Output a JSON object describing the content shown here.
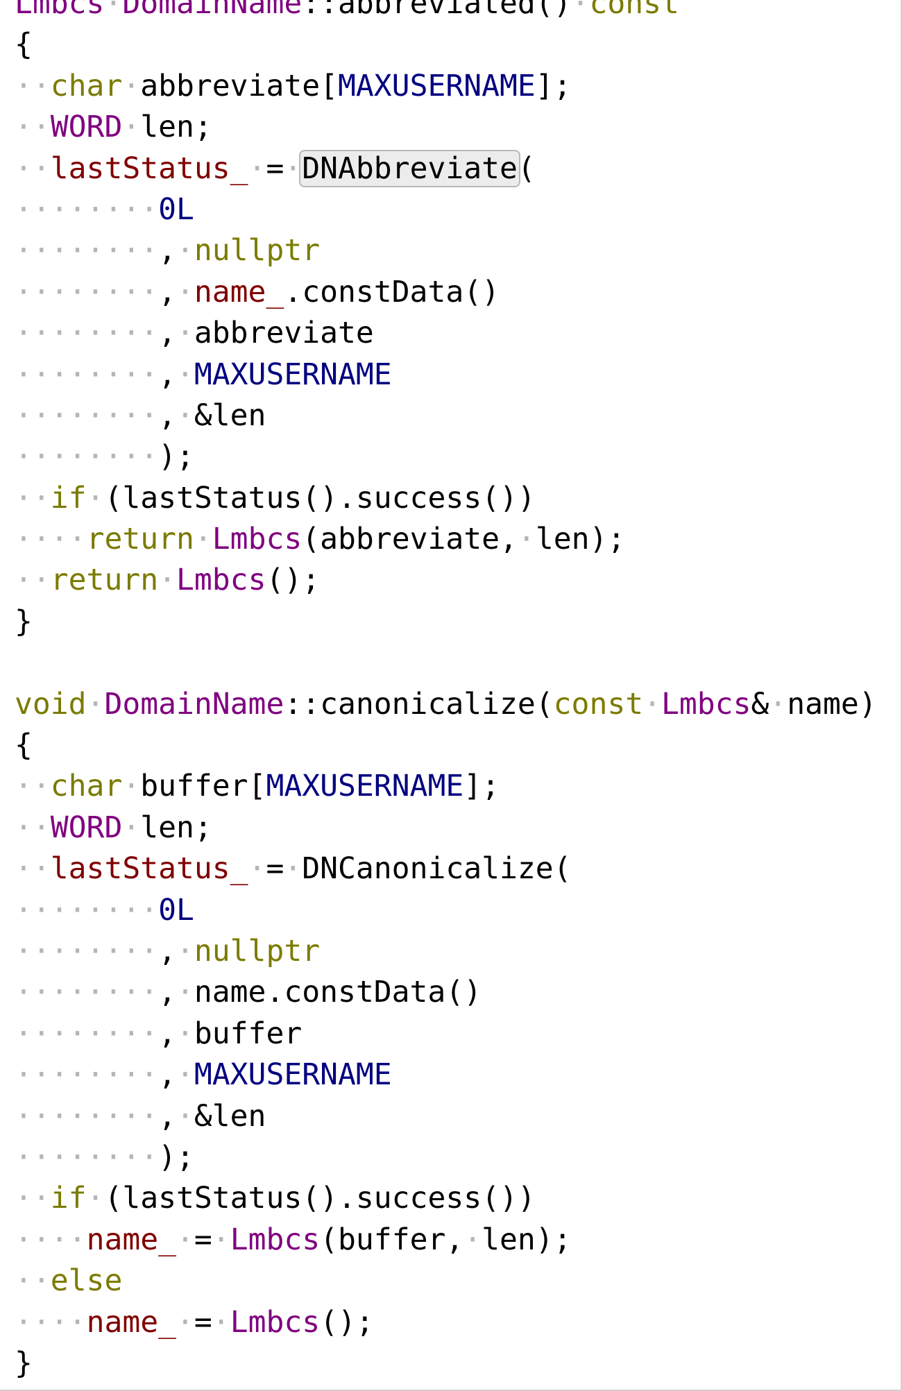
{
  "colors": {
    "plain": "#000000",
    "keyword": "#7b7b00",
    "type": "#800080",
    "constant": "#000080",
    "member": "#800000",
    "whitespace_marker": "#b5b5b5"
  },
  "code": {
    "lines": [
      [
        [
          "type",
          "Lmbcs"
        ],
        [
          "ws",
          "·"
        ],
        [
          "type",
          "DomainName"
        ],
        [
          "plain",
          "::abbreviated()"
        ],
        [
          "ws",
          "·"
        ],
        [
          "keyword",
          "const"
        ]
      ],
      [
        [
          "plain",
          "{"
        ]
      ],
      [
        [
          "ws",
          "··"
        ],
        [
          "keyword",
          "char"
        ],
        [
          "ws",
          "·"
        ],
        [
          "plain",
          "abbreviate["
        ],
        [
          "constant",
          "MAXUSERNAME"
        ],
        [
          "plain",
          "];"
        ]
      ],
      [
        [
          "ws",
          "··"
        ],
        [
          "type",
          "WORD"
        ],
        [
          "ws",
          "·"
        ],
        [
          "plain",
          "len;"
        ]
      ],
      [
        [
          "ws",
          "··"
        ],
        [
          "member",
          "lastStatus_"
        ],
        [
          "ws",
          "·"
        ],
        [
          "plain",
          "="
        ],
        [
          "ws",
          "·"
        ],
        [
          "highlight",
          "DNAbbreviate"
        ],
        [
          "plain",
          "("
        ]
      ],
      [
        [
          "ws",
          "········"
        ],
        [
          "constant",
          "0L"
        ]
      ],
      [
        [
          "ws",
          "········"
        ],
        [
          "plain",
          ","
        ],
        [
          "ws",
          "·"
        ],
        [
          "keyword",
          "nullptr"
        ]
      ],
      [
        [
          "ws",
          "········"
        ],
        [
          "plain",
          ","
        ],
        [
          "ws",
          "·"
        ],
        [
          "member",
          "name_"
        ],
        [
          "plain",
          ".constData()"
        ]
      ],
      [
        [
          "ws",
          "········"
        ],
        [
          "plain",
          ","
        ],
        [
          "ws",
          "·"
        ],
        [
          "plain",
          "abbreviate"
        ]
      ],
      [
        [
          "ws",
          "········"
        ],
        [
          "plain",
          ","
        ],
        [
          "ws",
          "·"
        ],
        [
          "constant",
          "MAXUSERNAME"
        ]
      ],
      [
        [
          "ws",
          "········"
        ],
        [
          "plain",
          ","
        ],
        [
          "ws",
          "·"
        ],
        [
          "plain",
          "&len"
        ]
      ],
      [
        [
          "ws",
          "········"
        ],
        [
          "plain",
          ");"
        ]
      ],
      [
        [
          "ws",
          "··"
        ],
        [
          "keyword",
          "if"
        ],
        [
          "ws",
          "·"
        ],
        [
          "plain",
          "(lastStatus().success())"
        ]
      ],
      [
        [
          "ws",
          "····"
        ],
        [
          "keyword",
          "return"
        ],
        [
          "ws",
          "·"
        ],
        [
          "type",
          "Lmbcs"
        ],
        [
          "plain",
          "(abbreviate,"
        ],
        [
          "ws",
          "·"
        ],
        [
          "plain",
          "len);"
        ]
      ],
      [
        [
          "ws",
          "··"
        ],
        [
          "keyword",
          "return"
        ],
        [
          "ws",
          "·"
        ],
        [
          "type",
          "Lmbcs"
        ],
        [
          "plain",
          "();"
        ]
      ],
      [
        [
          "plain",
          "}"
        ]
      ],
      [],
      [
        [
          "keyword",
          "void"
        ],
        [
          "ws",
          "·"
        ],
        [
          "type",
          "DomainName"
        ],
        [
          "plain",
          "::canonicalize("
        ],
        [
          "keyword",
          "const"
        ],
        [
          "ws",
          "·"
        ],
        [
          "type",
          "Lmbcs"
        ],
        [
          "plain",
          "&"
        ],
        [
          "ws",
          "·"
        ],
        [
          "plain",
          "name)"
        ]
      ],
      [
        [
          "plain",
          "{"
        ]
      ],
      [
        [
          "ws",
          "··"
        ],
        [
          "keyword",
          "char"
        ],
        [
          "ws",
          "·"
        ],
        [
          "plain",
          "buffer["
        ],
        [
          "constant",
          "MAXUSERNAME"
        ],
        [
          "plain",
          "];"
        ]
      ],
      [
        [
          "ws",
          "··"
        ],
        [
          "type",
          "WORD"
        ],
        [
          "ws",
          "·"
        ],
        [
          "plain",
          "len;"
        ]
      ],
      [
        [
          "ws",
          "··"
        ],
        [
          "member",
          "lastStatus_"
        ],
        [
          "ws",
          "·"
        ],
        [
          "plain",
          "="
        ],
        [
          "ws",
          "·"
        ],
        [
          "plain",
          "DNCanonicalize("
        ]
      ],
      [
        [
          "ws",
          "········"
        ],
        [
          "constant",
          "0L"
        ]
      ],
      [
        [
          "ws",
          "········"
        ],
        [
          "plain",
          ","
        ],
        [
          "ws",
          "·"
        ],
        [
          "keyword",
          "nullptr"
        ]
      ],
      [
        [
          "ws",
          "········"
        ],
        [
          "plain",
          ","
        ],
        [
          "ws",
          "·"
        ],
        [
          "plain",
          "name.constData()"
        ]
      ],
      [
        [
          "ws",
          "········"
        ],
        [
          "plain",
          ","
        ],
        [
          "ws",
          "·"
        ],
        [
          "plain",
          "buffer"
        ]
      ],
      [
        [
          "ws",
          "········"
        ],
        [
          "plain",
          ","
        ],
        [
          "ws",
          "·"
        ],
        [
          "constant",
          "MAXUSERNAME"
        ]
      ],
      [
        [
          "ws",
          "········"
        ],
        [
          "plain",
          ","
        ],
        [
          "ws",
          "·"
        ],
        [
          "plain",
          "&len"
        ]
      ],
      [
        [
          "ws",
          "········"
        ],
        [
          "plain",
          ");"
        ]
      ],
      [
        [
          "ws",
          "··"
        ],
        [
          "keyword",
          "if"
        ],
        [
          "ws",
          "·"
        ],
        [
          "plain",
          "(lastStatus().success())"
        ]
      ],
      [
        [
          "ws",
          "····"
        ],
        [
          "member",
          "name_"
        ],
        [
          "ws",
          "·"
        ],
        [
          "plain",
          "="
        ],
        [
          "ws",
          "·"
        ],
        [
          "type",
          "Lmbcs"
        ],
        [
          "plain",
          "(buffer,"
        ],
        [
          "ws",
          "·"
        ],
        [
          "plain",
          "len);"
        ]
      ],
      [
        [
          "ws",
          "··"
        ],
        [
          "keyword",
          "else"
        ]
      ],
      [
        [
          "ws",
          "····"
        ],
        [
          "member",
          "name_"
        ],
        [
          "ws",
          "·"
        ],
        [
          "plain",
          "="
        ],
        [
          "ws",
          "·"
        ],
        [
          "type",
          "Lmbcs"
        ],
        [
          "plain",
          "();"
        ]
      ],
      [
        [
          "plain",
          "}"
        ]
      ]
    ]
  }
}
